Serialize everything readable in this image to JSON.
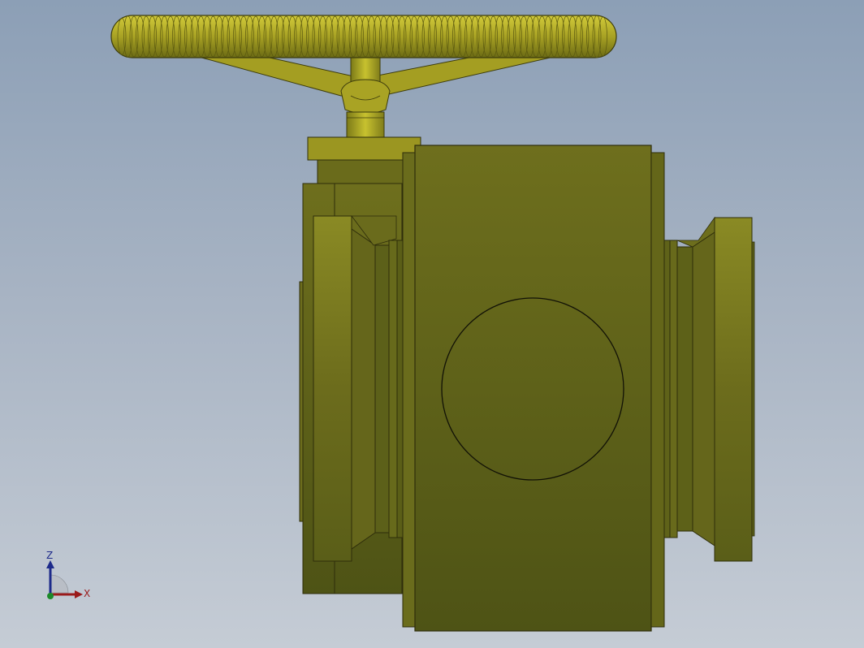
{
  "model": {
    "name": "",
    "colors": {
      "body_light": "#87852a",
      "body_mid": "#6e6e1d",
      "body_dark": "#4f5516",
      "bronze": "#c9c131",
      "outline": "#1a1a08",
      "background_top": "#8c9fb6",
      "background_bottom": "#c5ccd5"
    }
  },
  "triad": {
    "z_label": "Z",
    "x_label": "X",
    "z_color": "#1d2a8a",
    "x_color": "#9a1a1a",
    "y_color": "#1c8a2a"
  }
}
